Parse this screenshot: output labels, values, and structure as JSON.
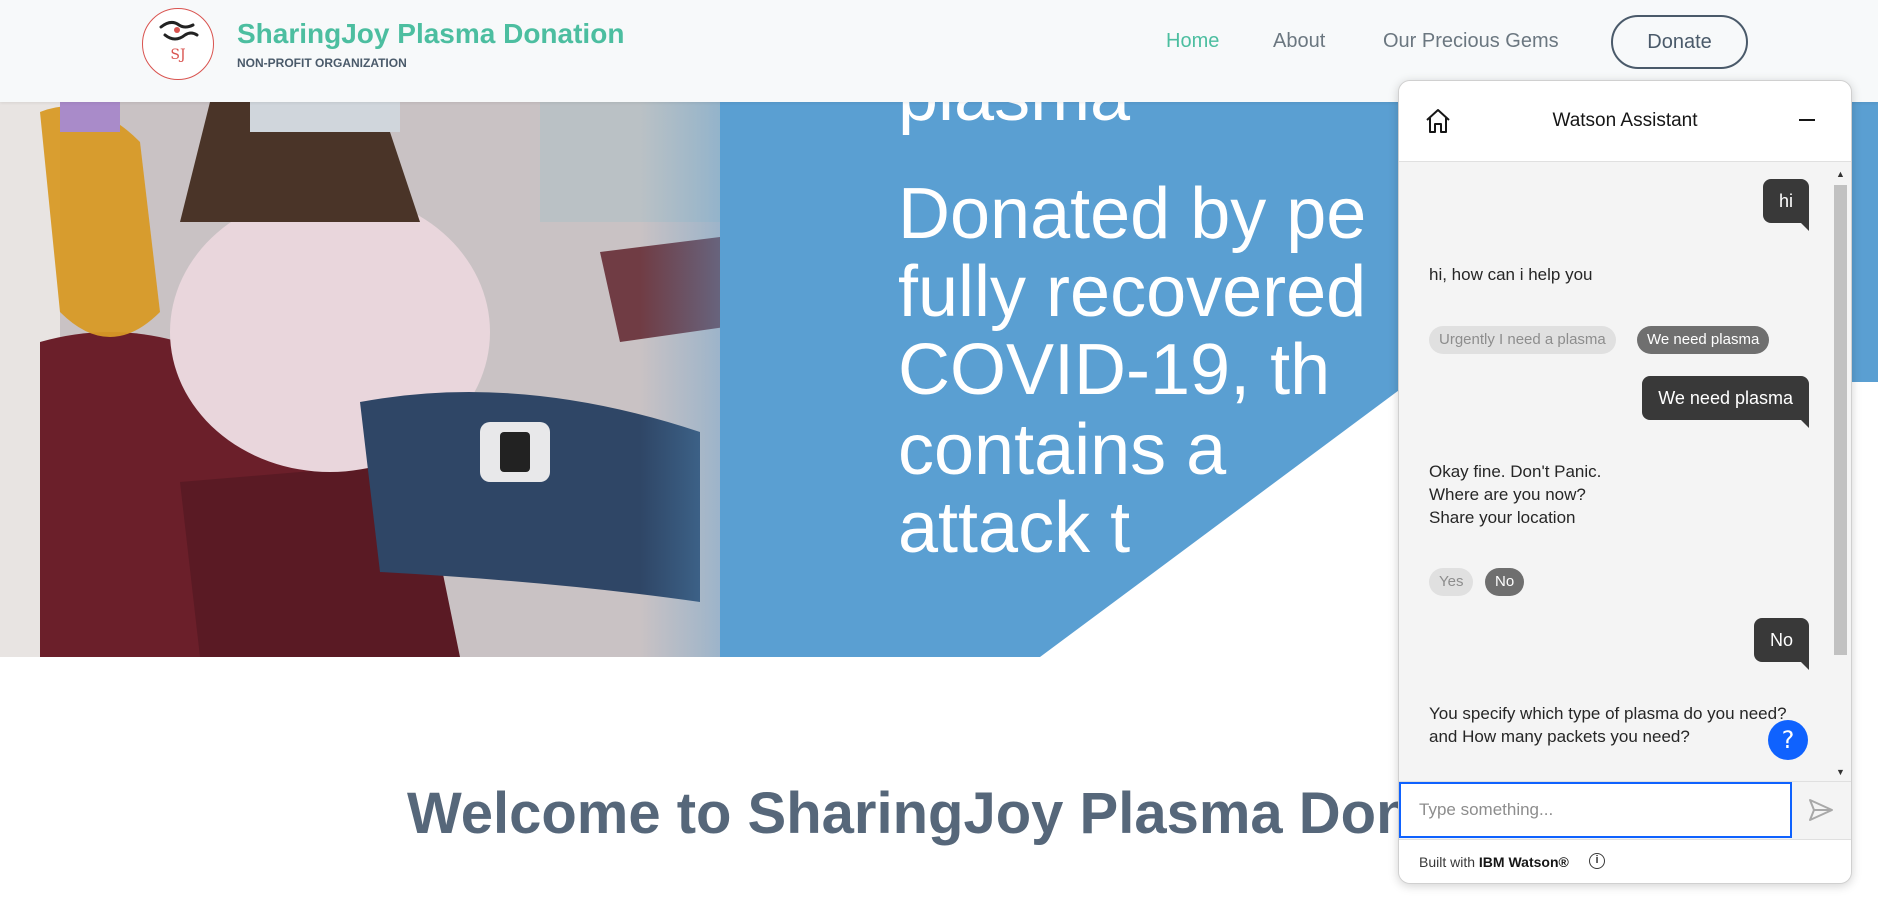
{
  "header": {
    "brand_title": "SharingJoy Plasma Donation",
    "brand_subtitle": "NON-PROFIT ORGANIZATION",
    "logo_text": "SJ",
    "nav": {
      "home": "Home",
      "about": "About",
      "gems": "Our Precious Gems",
      "donate": "Donate"
    },
    "active_color": "#4cbea0"
  },
  "hero": {
    "lines": [
      "plasma",
      "Donated by pe",
      "fully recovered",
      "COVID-19, th",
      "contains a",
      "attack t"
    ],
    "background_color": "#5a9fd2"
  },
  "welcome": {
    "title": "Welcome to SharingJoy Plasma Donati"
  },
  "chat": {
    "title": "Watson Assistant",
    "messages": {
      "user_1": "hi",
      "bot_1": "hi, how can i help you",
      "chip_urgent": "Urgently I need a plasma",
      "chip_need": "We need plasma",
      "user_2": "We need plasma",
      "bot_2_line1": "Okay fine. Don't Panic.",
      "bot_2_line2": "Where are you now?",
      "bot_2_line3": "Share your location",
      "chip_yes": "Yes",
      "chip_no": "No",
      "user_3": "No",
      "bot_3_line1": "You specify which type of plasma do you need?",
      "bot_3_line2": "and How many packets you need?"
    },
    "input_placeholder": "Type something...",
    "help_label": "?",
    "footer_prefix": "Built with",
    "footer_brand": "IBM Watson®",
    "accent_color": "#0f62fe"
  }
}
